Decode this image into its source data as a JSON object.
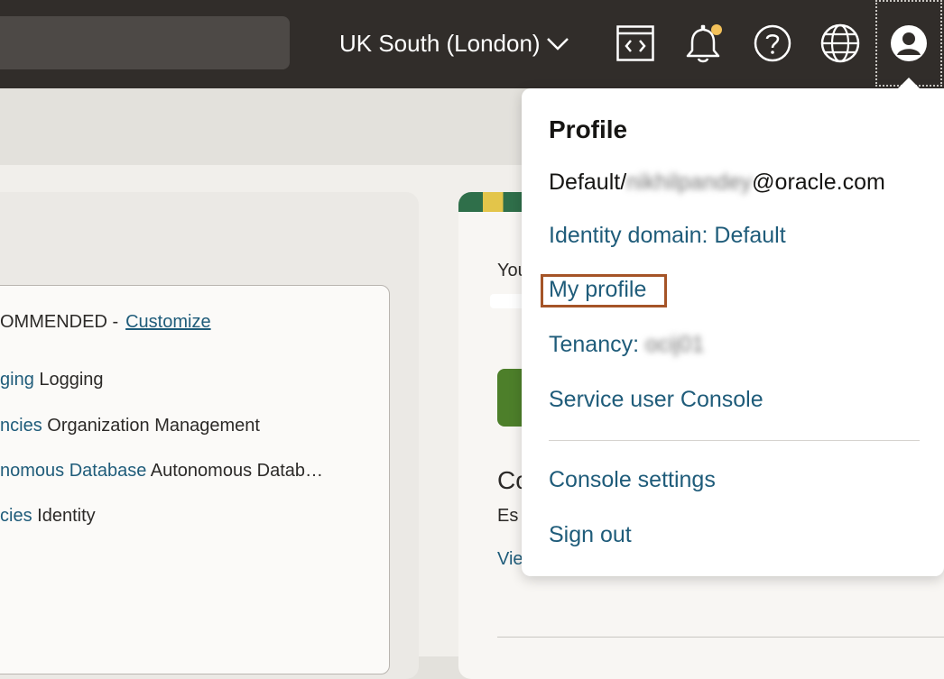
{
  "header": {
    "region_label": "UK South (London)",
    "icons": {
      "code_editor": "code-editor-icon",
      "notifications": "bell-icon",
      "help": "help-icon",
      "language": "globe-icon",
      "profile": "user-avatar-icon"
    },
    "notification_dot_color": "#f3c15a"
  },
  "background": {
    "recommended_label": "OMMENDED -",
    "customize_link": "Customize",
    "items": [
      {
        "link": "ging",
        "text": "Logging"
      },
      {
        "link": "ncies",
        "text": "Organization Management"
      },
      {
        "link": "nomous Database",
        "text": "Autonomous Datab…"
      },
      {
        "link": "cies",
        "text": "Identity"
      }
    ],
    "right_panel": {
      "you_text": "You",
      "co_text": "Co",
      "es_text": "Es",
      "vie_text": "Vie"
    }
  },
  "profile_menu": {
    "title": "Profile",
    "domain_prefix": "Default/",
    "email_masked": "nikhilpandey",
    "email_suffix": "@oracle.com",
    "identity_domain": "Identity domain: Default",
    "my_profile": "My profile",
    "tenancy_label": "Tenancy:",
    "tenancy_value_masked": "ocij01",
    "service_user_console": "Service user Console",
    "console_settings": "Console settings",
    "sign_out": "Sign out"
  },
  "colors": {
    "topbar": "#312d2a",
    "link": "#1f5c7a",
    "highlight": "#a55427"
  }
}
